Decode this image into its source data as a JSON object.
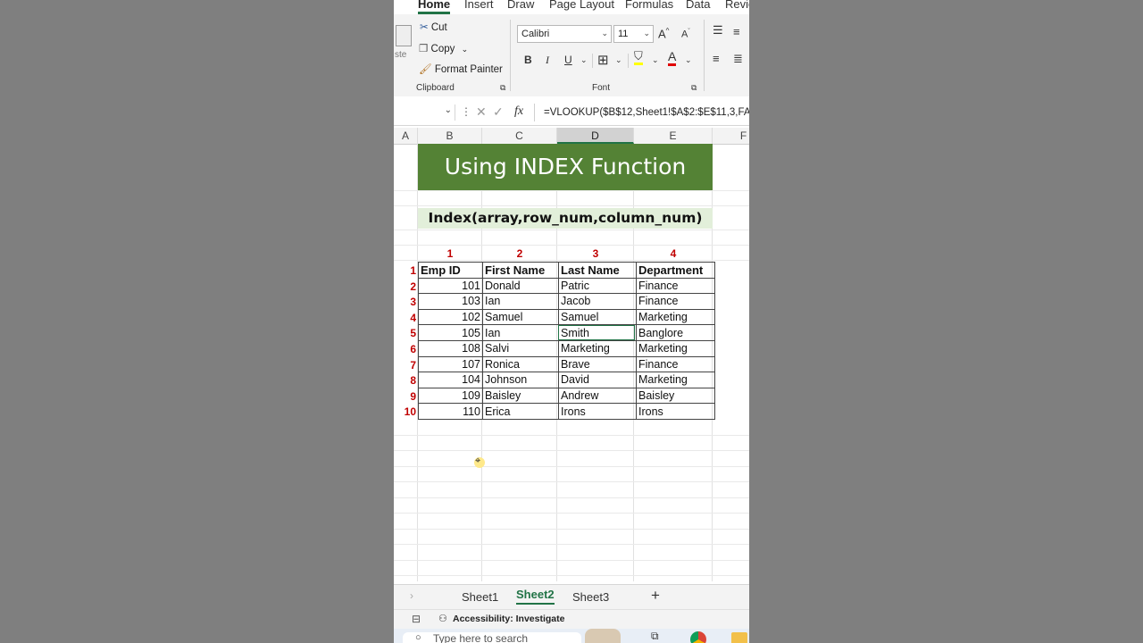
{
  "ribbon": {
    "tabs": [
      "Home",
      "Insert",
      "Draw",
      "Page Layout",
      "Formulas",
      "Data",
      "Revie"
    ],
    "clipboard": {
      "paste_partial": "ste",
      "cut": "Cut",
      "copy": "Copy",
      "format_painter": "Format Painter",
      "group_label": "Clipboard"
    },
    "font": {
      "family": "Calibri",
      "size": "11",
      "bold": "B",
      "italic": "I",
      "underline": "U",
      "font_color_glyph": "A",
      "increase_size": "A",
      "decrease_size": "A",
      "group_label": "Font"
    }
  },
  "formula_bar": {
    "fx": "fx",
    "formula": "=VLOOKUP($B$12,Sheet1!$A$2:$E$11,3,FA"
  },
  "grid": {
    "column_headers": [
      "A",
      "B",
      "C",
      "D",
      "E",
      "F"
    ],
    "selected_column": "D",
    "title": "Using INDEX Function",
    "subtitle": "Index(array,row_num,column_num)",
    "column_index_labels": [
      "1",
      "2",
      "3",
      "4"
    ],
    "row_index_labels": [
      "1",
      "2",
      "3",
      "4",
      "5",
      "6",
      "7",
      "8",
      "9",
      "10"
    ],
    "table_headers": [
      "Emp ID",
      "First Name",
      "Last Name",
      "Department"
    ],
    "table_rows": [
      [
        "101",
        "Donald",
        "Patric",
        "Finance"
      ],
      [
        "103",
        "Ian",
        "Jacob",
        "Finance"
      ],
      [
        "102",
        "Samuel",
        "Samuel",
        "Marketing"
      ],
      [
        "105",
        "Ian",
        "Smith",
        "Banglore"
      ],
      [
        "108",
        "Salvi",
        "Marketing",
        "Marketing"
      ],
      [
        "107",
        "Ronica",
        "Brave",
        "Finance"
      ],
      [
        "104",
        "Johnson",
        "David",
        "Marketing"
      ],
      [
        "109",
        "Baisley",
        "Andrew",
        "Baisley"
      ],
      [
        "110",
        "Erica",
        "Irons",
        "Irons"
      ]
    ]
  },
  "sheet_tabs": [
    "Sheet1",
    "Sheet2",
    "Sheet3"
  ],
  "active_sheet": "Sheet2",
  "add_sheet": "+",
  "status": {
    "accessibility": "Accessibility: Investigate"
  },
  "taskbar": {
    "search_placeholder": "Type here to search"
  },
  "colors": {
    "excel_green": "#217346",
    "title_fill": "#548235",
    "subtitle_fill": "#e2efda",
    "index_red": "#c00000"
  }
}
